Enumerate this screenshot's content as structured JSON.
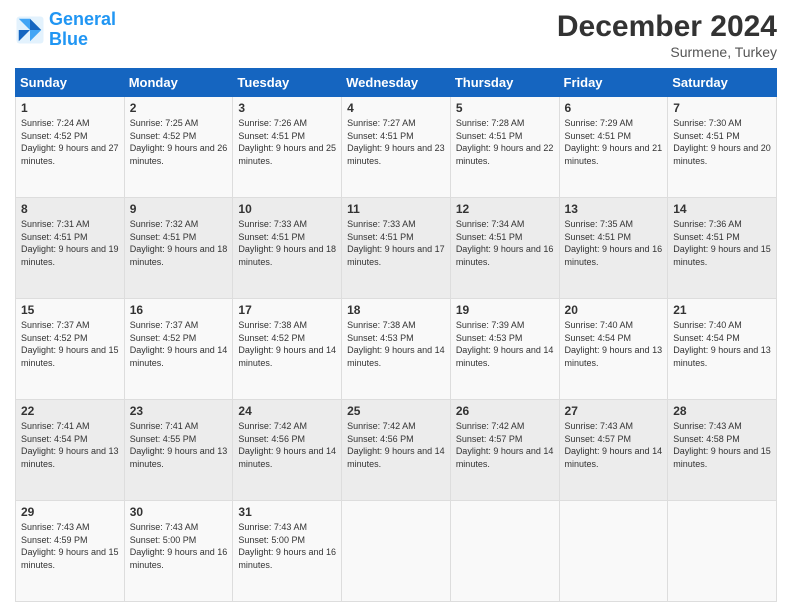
{
  "logo": {
    "line1": "General",
    "line2": "Blue"
  },
  "title": "December 2024",
  "subtitle": "Surmene, Turkey",
  "days_of_week": [
    "Sunday",
    "Monday",
    "Tuesday",
    "Wednesday",
    "Thursday",
    "Friday",
    "Saturday"
  ],
  "weeks": [
    [
      {
        "day": "1",
        "sunrise": "7:24 AM",
        "sunset": "4:52 PM",
        "daylight": "9 hours and 27 minutes."
      },
      {
        "day": "2",
        "sunrise": "7:25 AM",
        "sunset": "4:52 PM",
        "daylight": "9 hours and 26 minutes."
      },
      {
        "day": "3",
        "sunrise": "7:26 AM",
        "sunset": "4:51 PM",
        "daylight": "9 hours and 25 minutes."
      },
      {
        "day": "4",
        "sunrise": "7:27 AM",
        "sunset": "4:51 PM",
        "daylight": "9 hours and 23 minutes."
      },
      {
        "day": "5",
        "sunrise": "7:28 AM",
        "sunset": "4:51 PM",
        "daylight": "9 hours and 22 minutes."
      },
      {
        "day": "6",
        "sunrise": "7:29 AM",
        "sunset": "4:51 PM",
        "daylight": "9 hours and 21 minutes."
      },
      {
        "day": "7",
        "sunrise": "7:30 AM",
        "sunset": "4:51 PM",
        "daylight": "9 hours and 20 minutes."
      }
    ],
    [
      {
        "day": "8",
        "sunrise": "7:31 AM",
        "sunset": "4:51 PM",
        "daylight": "9 hours and 19 minutes."
      },
      {
        "day": "9",
        "sunrise": "7:32 AM",
        "sunset": "4:51 PM",
        "daylight": "9 hours and 18 minutes."
      },
      {
        "day": "10",
        "sunrise": "7:33 AM",
        "sunset": "4:51 PM",
        "daylight": "9 hours and 18 minutes."
      },
      {
        "day": "11",
        "sunrise": "7:33 AM",
        "sunset": "4:51 PM",
        "daylight": "9 hours and 17 minutes."
      },
      {
        "day": "12",
        "sunrise": "7:34 AM",
        "sunset": "4:51 PM",
        "daylight": "9 hours and 16 minutes."
      },
      {
        "day": "13",
        "sunrise": "7:35 AM",
        "sunset": "4:51 PM",
        "daylight": "9 hours and 16 minutes."
      },
      {
        "day": "14",
        "sunrise": "7:36 AM",
        "sunset": "4:51 PM",
        "daylight": "9 hours and 15 minutes."
      }
    ],
    [
      {
        "day": "15",
        "sunrise": "7:37 AM",
        "sunset": "4:52 PM",
        "daylight": "9 hours and 15 minutes."
      },
      {
        "day": "16",
        "sunrise": "7:37 AM",
        "sunset": "4:52 PM",
        "daylight": "9 hours and 14 minutes."
      },
      {
        "day": "17",
        "sunrise": "7:38 AM",
        "sunset": "4:52 PM",
        "daylight": "9 hours and 14 minutes."
      },
      {
        "day": "18",
        "sunrise": "7:38 AM",
        "sunset": "4:53 PM",
        "daylight": "9 hours and 14 minutes."
      },
      {
        "day": "19",
        "sunrise": "7:39 AM",
        "sunset": "4:53 PM",
        "daylight": "9 hours and 14 minutes."
      },
      {
        "day": "20",
        "sunrise": "7:40 AM",
        "sunset": "4:54 PM",
        "daylight": "9 hours and 13 minutes."
      },
      {
        "day": "21",
        "sunrise": "7:40 AM",
        "sunset": "4:54 PM",
        "daylight": "9 hours and 13 minutes."
      }
    ],
    [
      {
        "day": "22",
        "sunrise": "7:41 AM",
        "sunset": "4:54 PM",
        "daylight": "9 hours and 13 minutes."
      },
      {
        "day": "23",
        "sunrise": "7:41 AM",
        "sunset": "4:55 PM",
        "daylight": "9 hours and 13 minutes."
      },
      {
        "day": "24",
        "sunrise": "7:42 AM",
        "sunset": "4:56 PM",
        "daylight": "9 hours and 14 minutes."
      },
      {
        "day": "25",
        "sunrise": "7:42 AM",
        "sunset": "4:56 PM",
        "daylight": "9 hours and 14 minutes."
      },
      {
        "day": "26",
        "sunrise": "7:42 AM",
        "sunset": "4:57 PM",
        "daylight": "9 hours and 14 minutes."
      },
      {
        "day": "27",
        "sunrise": "7:43 AM",
        "sunset": "4:57 PM",
        "daylight": "9 hours and 14 minutes."
      },
      {
        "day": "28",
        "sunrise": "7:43 AM",
        "sunset": "4:58 PM",
        "daylight": "9 hours and 15 minutes."
      }
    ],
    [
      {
        "day": "29",
        "sunrise": "7:43 AM",
        "sunset": "4:59 PM",
        "daylight": "9 hours and 15 minutes."
      },
      {
        "day": "30",
        "sunrise": "7:43 AM",
        "sunset": "5:00 PM",
        "daylight": "9 hours and 16 minutes."
      },
      {
        "day": "31",
        "sunrise": "7:43 AM",
        "sunset": "5:00 PM",
        "daylight": "9 hours and 16 minutes."
      },
      null,
      null,
      null,
      null
    ]
  ],
  "labels": {
    "sunrise": "Sunrise:",
    "sunset": "Sunset:",
    "daylight": "Daylight:"
  }
}
